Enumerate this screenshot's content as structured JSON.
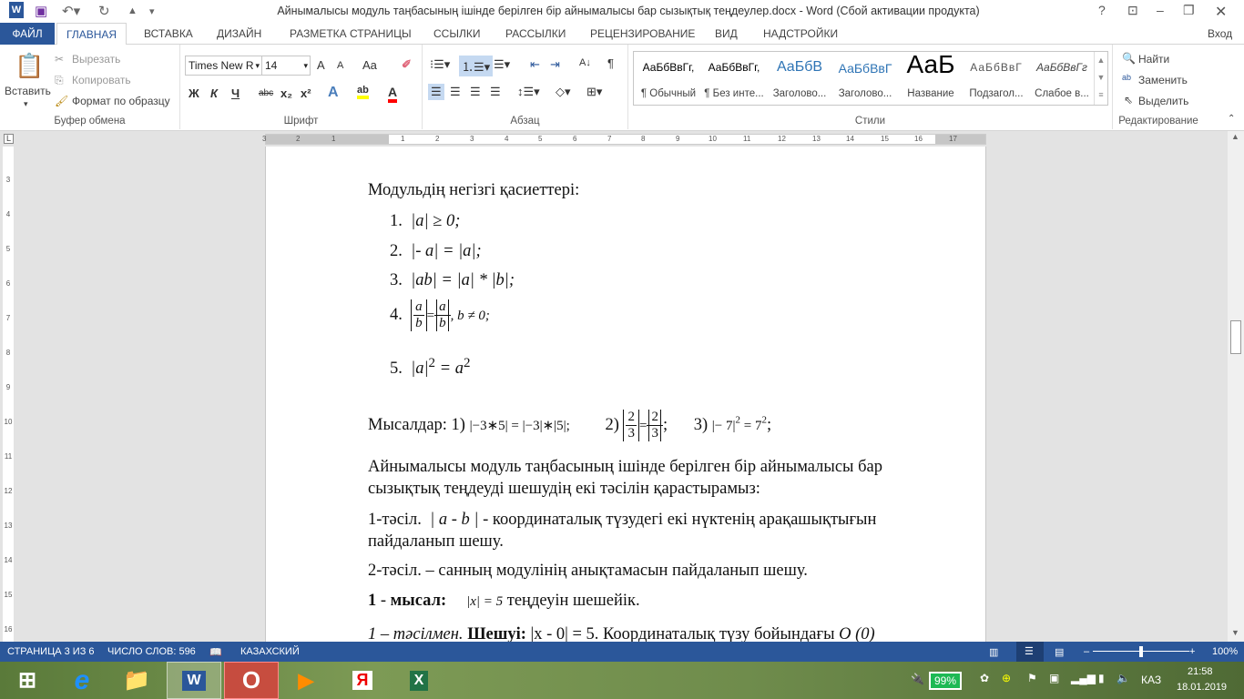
{
  "window": {
    "title": "Айнымалысы модуль таңбасының ішінде берілген бір айнымалысы бар сызықтық теңдеулер.docx - Word (Сбой активации продукта)",
    "help": "?",
    "signin": "Вход"
  },
  "tabs": [
    "ФАЙЛ",
    "ГЛАВНАЯ",
    "ВСТАВКА",
    "ДИЗАЙН",
    "РАЗМЕТКА СТРАНИЦЫ",
    "ССЫЛКИ",
    "РАССЫЛКИ",
    "РЕЦЕНЗИРОВАНИЕ",
    "ВИД",
    "НАДСТРОЙКИ"
  ],
  "clipboard": {
    "paste": "Вставить",
    "cut": "Вырезать",
    "copy": "Копировать",
    "format_painter": "Формат по образцу",
    "label": "Буфер обмена"
  },
  "font": {
    "name": "Times New R",
    "size": "14",
    "bold": "Ж",
    "italic": "К",
    "underline": "Ч",
    "strike": "abc",
    "sub": "x₂",
    "sup": "x²",
    "change_case": "Aa",
    "grow": "A",
    "shrink": "A",
    "label": "Шрифт",
    "highlight_color": "#ffff00",
    "font_color": "#ff0000"
  },
  "paragraph": {
    "label": "Абзац",
    "pilcrow": "¶"
  },
  "styles": {
    "label": "Стили",
    "items": [
      {
        "preview": "АаБбВвГг,",
        "name": "¶ Обычный"
      },
      {
        "preview": "АаБбВвГг,",
        "name": "¶ Без инте..."
      },
      {
        "preview": "АаБбВ",
        "name": "Заголово..."
      },
      {
        "preview": "АаБбВвГ",
        "name": "Заголово..."
      },
      {
        "preview": "АаБ",
        "name": "Название"
      },
      {
        "preview": "АаБбВвГ",
        "name": "Подзагол..."
      },
      {
        "preview": "АаБбВвГг",
        "name": "Слабое в..."
      }
    ]
  },
  "editing": {
    "find": "Найти",
    "replace": "Заменить",
    "select": "Выделить",
    "label": "Редактирование"
  },
  "ruler": [
    "3",
    "2",
    "1",
    "1",
    "2",
    "3",
    "4",
    "5",
    "6",
    "7",
    "8",
    "9",
    "10",
    "11",
    "12",
    "13",
    "14",
    "15",
    "16",
    "17"
  ],
  "vruler": [
    "3",
    "4",
    "5",
    "6",
    "7",
    "8",
    "9",
    "10",
    "11",
    "12",
    "13",
    "14",
    "15",
    "16"
  ],
  "document": {
    "heading": "Модульдің негізгі қасиеттері:",
    "props": [
      {
        "num": "1.",
        "expr": "|a| ≥ 0;"
      },
      {
        "num": "2.",
        "expr": "|- a| = |a|;"
      },
      {
        "num": "3.",
        "expr": "|ab| = |a| * |b|;"
      },
      {
        "num": "4.",
        "a": "a",
        "b": "b",
        "tail": ", b ≠ 0;"
      },
      {
        "num": "5.",
        "lhs": "|a|",
        "exp": "2",
        "eq": " = a",
        "exp2": "2"
      }
    ],
    "examples_label": "Мысалдар: 1)",
    "ex1": "|−3∗5| = |−3|∗|5|;",
    "ex2_label": "2)",
    "ex2_num": "2",
    "ex2_den": "3",
    "ex2_tail": ";",
    "ex3_label": "3)",
    "ex3": "|− 7|",
    "ex3_exp": "2",
    "ex3_eq": " = 7",
    "ex3_exp2": "2",
    "ex3_tail": ";",
    "p1_line1": "Айнымалысы модуль таңбасының ішінде берілген бір айнымалысы бар",
    "p1_line2": "сызықтық теңдеуді шешудің екі тәсілін қарастырамыз:",
    "m1_label": "1-тәсіл.",
    "m1_expr": "| a - b |",
    "m1_text": " - координаталық түзудегі екі нүктенің арақашықтығын",
    "m1_line2": "пайдаланып шешу.",
    "m2": "2-тәсіл. – санның модулінің анықтамасын пайдаланып шешу.",
    "ex_num": "1",
    "ex_dash": " - ",
    "ex_word": "мысал:",
    "ex_eq": "|x| = 5",
    "ex_text": " теңдеуін шешейік.",
    "sol_italic": "1 – тәсілмен.",
    "sol_bold": " Шешуі:",
    "sol_rest": " |x - 0| = 5. Координаталық түзу бойындағы ",
    "sol_o": "O (0)"
  },
  "status": {
    "page": "СТРАНИЦА 3 ИЗ 6",
    "words": "ЧИСЛО СЛОВ: 596",
    "language": "КАЗАХСКИЙ",
    "zoom": "100%",
    "zoom_level": 100
  },
  "taskbar": {
    "battery": "99%",
    "lang": "КАЗ",
    "time": "21:58",
    "date": "18.01.2019",
    "ie": "e",
    "word": "W",
    "opera": "O",
    "yandex": "Я",
    "excel": "X"
  }
}
